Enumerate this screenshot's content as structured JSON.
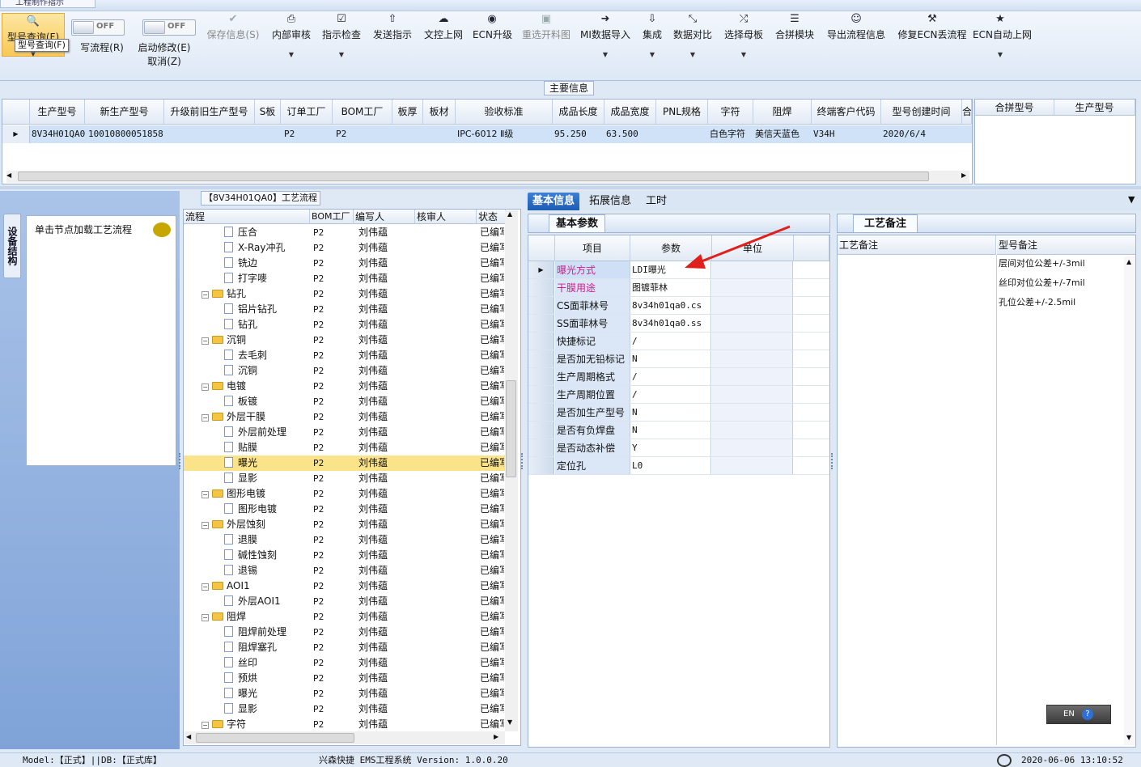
{
  "top_tab": "工程制作指示",
  "ribbon": {
    "query_btn": "型号查询(F)",
    "write_flow_btn": "写流程(R)",
    "toggle_off": "OFF",
    "enable_edit_btn": "启动修改(E)",
    "cancel_btn": "取消(Z)",
    "save_btn": "保存信息(S)",
    "internal_review_btn": "内部审核",
    "instruction_check_btn": "指示检查",
    "send_instruction_btn": "发送指示",
    "file_upload_btn": "文控上网",
    "ecn_upgrade_btn": "ECN升级",
    "reselect_drawing_btn": "重选开料图",
    "mi_import_btn": "MI数据导入",
    "integrate_btn": "集成",
    "data_compare_btn": "数据对比",
    "select_master_btn": "选择母板",
    "merge_module_btn": "合拼模块",
    "export_flow_btn": "导出流程信息",
    "fix_ecn_btn": "修复ECN丢流程",
    "ecn_auto_online_btn": "ECN自动上网",
    "tooltip": "型号查询(F)"
  },
  "main_info": {
    "label": "主要信息",
    "columns": [
      "生产型号",
      "新生产型号",
      "升级前旧生产型号",
      "S板",
      "订单工厂",
      "BOM工厂",
      "板厚",
      "板材",
      "验收标准",
      "成品长度",
      "成品宽度",
      "PNL规格",
      "字符",
      "阻焊",
      "终端客户代码",
      "型号创建时间",
      "合"
    ],
    "row": [
      "8V34H01QA0",
      "10010800051858",
      "",
      "",
      "P2",
      "P2",
      "",
      "",
      "IPC-6012 Ⅱ级",
      "95.250",
      "63.500",
      "",
      "白色字符",
      "美信天蓝色",
      "V34H",
      "2020/6/4",
      ""
    ],
    "merge_columns": [
      "合拼型号",
      "生产型号"
    ]
  },
  "left_panel": {
    "side_tab": "设备结构",
    "click_hint": "单击节点加载工艺流程"
  },
  "flow": {
    "title": "【8V34H01QA0】工艺流程",
    "columns": [
      "流程",
      "BOM工厂",
      "编写人",
      "核审人",
      "状态"
    ],
    "rows": [
      {
        "level": 2,
        "type": "item",
        "name": "压合",
        "bom": "P2",
        "writer": "刘伟蕴",
        "status": "已编写"
      },
      {
        "level": 2,
        "type": "item",
        "name": "X-Ray冲孔",
        "bom": "P2",
        "writer": "刘伟蕴",
        "status": "已编写"
      },
      {
        "level": 2,
        "type": "item",
        "name": "铣边",
        "bom": "P2",
        "writer": "刘伟蕴",
        "status": "已编写"
      },
      {
        "level": 2,
        "type": "item",
        "name": "打字嘜",
        "bom": "P2",
        "writer": "刘伟蕴",
        "status": "已编写"
      },
      {
        "level": 1,
        "type": "folder",
        "name": "钻孔",
        "bom": "P2",
        "writer": "刘伟蕴",
        "status": "已编写"
      },
      {
        "level": 2,
        "type": "item",
        "name": "铝片钻孔",
        "bom": "P2",
        "writer": "刘伟蕴",
        "status": "已编写"
      },
      {
        "level": 2,
        "type": "item",
        "name": "钻孔",
        "bom": "P2",
        "writer": "刘伟蕴",
        "status": "已编写"
      },
      {
        "level": 1,
        "type": "folder",
        "name": "沉铜",
        "bom": "P2",
        "writer": "刘伟蕴",
        "status": "已编写"
      },
      {
        "level": 2,
        "type": "item",
        "name": "去毛刺",
        "bom": "P2",
        "writer": "刘伟蕴",
        "status": "已编写"
      },
      {
        "level": 2,
        "type": "item",
        "name": "沉铜",
        "bom": "P2",
        "writer": "刘伟蕴",
        "status": "已编写"
      },
      {
        "level": 1,
        "type": "folder",
        "name": "电镀",
        "bom": "P2",
        "writer": "刘伟蕴",
        "status": "已编写"
      },
      {
        "level": 2,
        "type": "item",
        "name": "板镀",
        "bom": "P2",
        "writer": "刘伟蕴",
        "status": "已编写"
      },
      {
        "level": 1,
        "type": "folder",
        "name": "外层干膜",
        "bom": "P2",
        "writer": "刘伟蕴",
        "status": "已编写"
      },
      {
        "level": 2,
        "type": "item",
        "name": "外层前处理",
        "bom": "P2",
        "writer": "刘伟蕴",
        "status": "已编写"
      },
      {
        "level": 2,
        "type": "item",
        "name": "贴膜",
        "bom": "P2",
        "writer": "刘伟蕴",
        "status": "已编写"
      },
      {
        "level": 2,
        "type": "item",
        "name": "曝光",
        "bom": "P2",
        "writer": "刘伟蕴",
        "status": "已编写",
        "selected": true
      },
      {
        "level": 2,
        "type": "item",
        "name": "显影",
        "bom": "P2",
        "writer": "刘伟蕴",
        "status": "已编写"
      },
      {
        "level": 1,
        "type": "folder",
        "name": "图形电镀",
        "bom": "P2",
        "writer": "刘伟蕴",
        "status": "已编写"
      },
      {
        "level": 2,
        "type": "item",
        "name": "图形电镀",
        "bom": "P2",
        "writer": "刘伟蕴",
        "status": "已编写"
      },
      {
        "level": 1,
        "type": "folder",
        "name": "外层蚀刻",
        "bom": "P2",
        "writer": "刘伟蕴",
        "status": "已编写"
      },
      {
        "level": 2,
        "type": "item",
        "name": "退膜",
        "bom": "P2",
        "writer": "刘伟蕴",
        "status": "已编写"
      },
      {
        "level": 2,
        "type": "item",
        "name": "碱性蚀刻",
        "bom": "P2",
        "writer": "刘伟蕴",
        "status": "已编写"
      },
      {
        "level": 2,
        "type": "item",
        "name": "退锡",
        "bom": "P2",
        "writer": "刘伟蕴",
        "status": "已编写"
      },
      {
        "level": 1,
        "type": "folder",
        "name": "AOI1",
        "bom": "P2",
        "writer": "刘伟蕴",
        "status": "已编写"
      },
      {
        "level": 2,
        "type": "item",
        "name": "外层AOI1",
        "bom": "P2",
        "writer": "刘伟蕴",
        "status": "已编写"
      },
      {
        "level": 1,
        "type": "folder",
        "name": "阻焊",
        "bom": "P2",
        "writer": "刘伟蕴",
        "status": "已编写"
      },
      {
        "level": 2,
        "type": "item",
        "name": "阻焊前处理",
        "bom": "P2",
        "writer": "刘伟蕴",
        "status": "已编写"
      },
      {
        "level": 2,
        "type": "item",
        "name": "阻焊塞孔",
        "bom": "P2",
        "writer": "刘伟蕴",
        "status": "已编写"
      },
      {
        "level": 2,
        "type": "item",
        "name": "丝印",
        "bom": "P2",
        "writer": "刘伟蕴",
        "status": "已编写"
      },
      {
        "level": 2,
        "type": "item",
        "name": "预烘",
        "bom": "P2",
        "writer": "刘伟蕴",
        "status": "已编写"
      },
      {
        "level": 2,
        "type": "item",
        "name": "曝光",
        "bom": "P2",
        "writer": "刘伟蕴",
        "status": "已编写"
      },
      {
        "level": 2,
        "type": "item",
        "name": "显影",
        "bom": "P2",
        "writer": "刘伟蕴",
        "status": "已编写"
      },
      {
        "level": 1,
        "type": "folder",
        "name": "字符",
        "bom": "P2",
        "writer": "刘伟蕴",
        "status": "已编写"
      }
    ]
  },
  "right_tabs": [
    "基本信息",
    "拓展信息",
    "工时"
  ],
  "basic_params": {
    "tab": "基本参数",
    "columns": [
      "项目",
      "参数",
      "单位"
    ],
    "rows": [
      {
        "name": "曝光方式",
        "value": "LDI曝光",
        "color": "#cc1f8a"
      },
      {
        "name": "干膜用途",
        "value": "图镀菲林",
        "color": "#cc1f8a"
      },
      {
        "name": "CS面菲林号",
        "value": "8v34h01qa0.cs"
      },
      {
        "name": "SS面菲林号",
        "value": "8v34h01qa0.ss"
      },
      {
        "name": "快捷标记",
        "value": "/"
      },
      {
        "name": "是否加无铅标记",
        "value": "N"
      },
      {
        "name": "生产周期格式",
        "value": "/"
      },
      {
        "name": "生产周期位置",
        "value": "/"
      },
      {
        "name": "是否加生产型号",
        "value": "N"
      },
      {
        "name": "是否有负焊盘",
        "value": "N"
      },
      {
        "name": "是否动态补偿",
        "value": "Y"
      },
      {
        "name": "定位孔",
        "value": "L0"
      }
    ]
  },
  "craft_notes": {
    "tab": "工艺备注",
    "col1": "工艺备注",
    "col2": "型号备注",
    "notes": [
      "层间对位公差+/-3mil",
      "丝印对位公差+/-7mil",
      "孔位公差+/-2.5mil"
    ]
  },
  "ime": "EN",
  "status_bar": {
    "model": "Model:【正式】||DB:【正式库】",
    "system": "兴森快捷 EMS工程系统 Version: 1.0.0.20",
    "datetime": "2020-06-06 13:10:52"
  },
  "colors": {
    "accent": "#1d5cb4",
    "selected_row": "#fbe38a",
    "grid_row": "#cfe2f8",
    "annotation_arrow": "#e0201c"
  }
}
